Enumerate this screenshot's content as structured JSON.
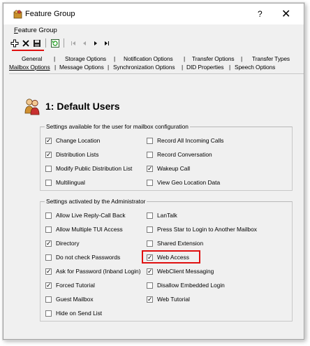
{
  "window": {
    "title": "Feature Group",
    "help_glyph": "?",
    "close_glyph": "✕"
  },
  "menu": {
    "items": [
      {
        "label_first": "F",
        "label_rest": "eature Group"
      }
    ]
  },
  "toolbar": {
    "icons": [
      "add-icon",
      "delete-icon",
      "save-icon",
      "refresh-icon",
      "first-record-icon",
      "previous-record-icon",
      "next-record-icon",
      "last-record-icon"
    ]
  },
  "tabs": {
    "row1": [
      "General",
      "Storage Options",
      "Notification Options",
      "Transfer Options",
      "Transfer Types"
    ],
    "row2": [
      "Mailbox Options",
      "Message Options",
      "Synchronization Options",
      "DID Properties",
      "Speech Options"
    ],
    "active": "Mailbox Options",
    "separator": "|"
  },
  "page": {
    "title": "1: Default Users"
  },
  "user_group": {
    "legend": "Settings available for the user for mailbox configuration",
    "left": [
      {
        "label": "Change Location",
        "checked": true
      },
      {
        "label": "Distribution Lists",
        "checked": true
      },
      {
        "label": "Modify Public Distribution List",
        "checked": false
      },
      {
        "label": "Multilingual",
        "checked": false
      }
    ],
    "right": [
      {
        "label": "Record All Incoming Calls",
        "checked": false
      },
      {
        "label": "Record Conversation",
        "checked": false
      },
      {
        "label": "Wakeup Call",
        "checked": true
      },
      {
        "label": "View Geo Location Data",
        "checked": false
      }
    ]
  },
  "admin_group": {
    "legend": "Settings activated by the Administrator",
    "left": [
      {
        "label": "Allow Live Reply-Call Back",
        "checked": false
      },
      {
        "label": "Allow Multiple TUI Access",
        "checked": false
      },
      {
        "label": "Directory",
        "checked": true
      },
      {
        "label": "Do not check Passwords",
        "checked": false
      },
      {
        "label": "Ask for Password (Inband Login)",
        "checked": true
      },
      {
        "label": "Forced Tutorial",
        "checked": true
      },
      {
        "label": "Guest Mailbox",
        "checked": false
      },
      {
        "label": "Hide on Send List",
        "checked": false
      }
    ],
    "right": [
      {
        "label": "LanTalk",
        "checked": false
      },
      {
        "label": "Press Star to Login to Another Mailbox",
        "checked": false
      },
      {
        "label": "Shared Extension",
        "checked": false
      },
      {
        "label": "Web Access",
        "checked": true
      },
      {
        "label": "WebClient Messaging",
        "checked": true
      },
      {
        "label": "Disallow Embedded Login",
        "checked": false
      },
      {
        "label": "Web Tutorial",
        "checked": true
      }
    ]
  },
  "colors": {
    "highlight": "#e01010",
    "window_bg": "#f0f0f0",
    "titlebar_bg": "#ffffff"
  }
}
